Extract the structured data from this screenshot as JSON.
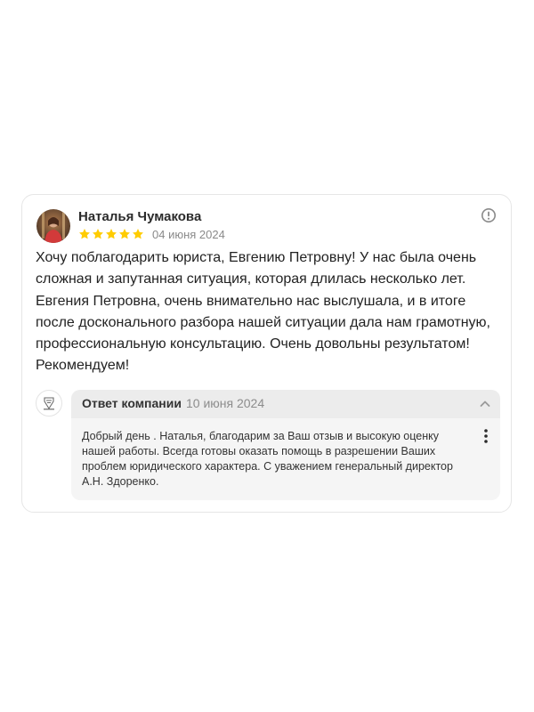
{
  "review": {
    "author": "Наталья Чумакова",
    "rating": 5,
    "rating_max": 5,
    "date": "04 июня 2024",
    "text": "Хочу поблагодарить юриста, Евгению Петровну! У нас была очень сложная и запутанная ситуация, которая длилась несколько лет. Евгения Петровна, очень внимательно нас выслушала, и в итоге после досконального разбора нашей ситуации дала нам грамотную, профессиональную консультацию. Очень довольны результатом! Рекомендуем!",
    "star_color": "#ffcc00",
    "complain_icon": "exclamation-circle-icon"
  },
  "reply": {
    "title": "Ответ компании",
    "date": "10 июня 2024",
    "text": "Добрый день . Наталья, благодарим за Ваш отзыв и высокую оценку нашей работы. Всегда готовы оказать помощь в разрешении Ваших проблем юридического характера. С уважением генеральный директор А.Н. Здоренко.",
    "collapse_icon": "chevron-up-icon",
    "more_icon": "more-vertical-icon"
  }
}
